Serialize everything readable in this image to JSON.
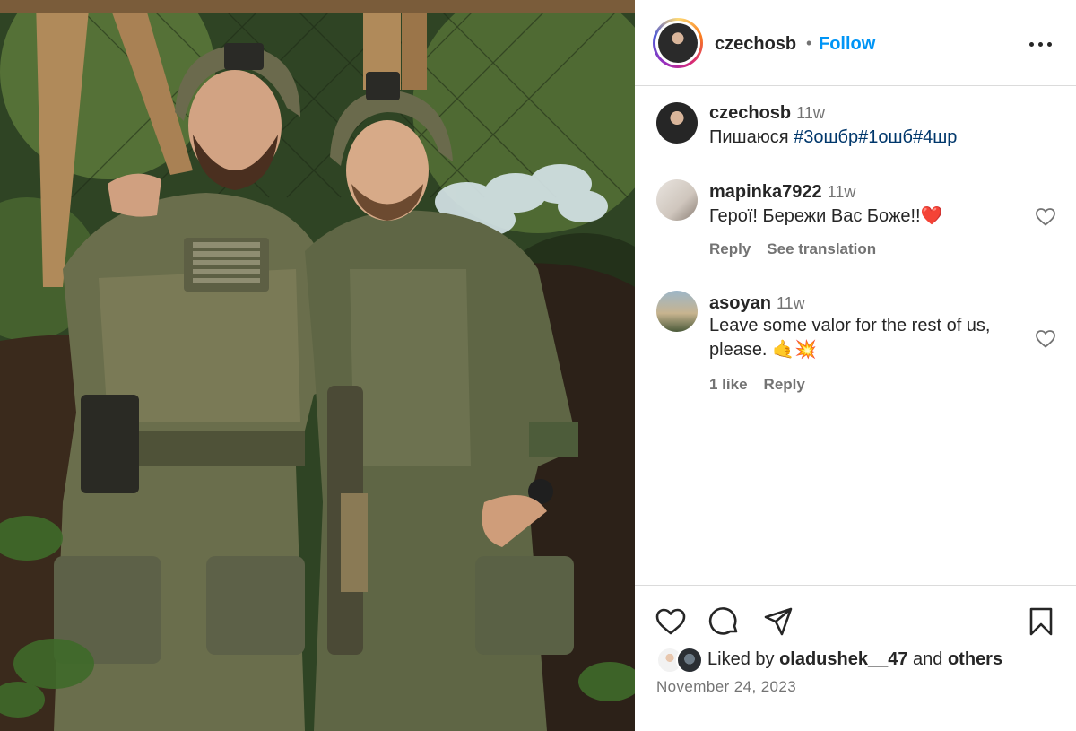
{
  "post": {
    "author": "czechosb",
    "follow_label": "Follow",
    "separator": "•",
    "caption": {
      "user": "czechosb",
      "time": "11w",
      "text": "Пишаюся ",
      "hashtags": "#3ошбр#1ошб#4шр"
    },
    "comments": [
      {
        "user": "mapinka7922",
        "time": "11w",
        "text": "Герої! Бережи Вас Боже!!❤️",
        "reply_label": "Reply",
        "translate_label": "See translation"
      },
      {
        "user": "asoyan",
        "time": "11w",
        "text": "Leave some valor for the rest of us, please. 🤙💥",
        "likes_label": "1 like",
        "reply_label": "Reply"
      }
    ],
    "liked_by": {
      "prefix": "Liked by ",
      "user": "oladushek__47",
      "middle": " and ",
      "others": "others"
    },
    "date": "November 24, 2023"
  },
  "icons": {
    "more": "more-options-icon",
    "heart": "heart-icon",
    "comment": "comment-icon",
    "share": "share-icon",
    "save": "bookmark-icon"
  },
  "colors": {
    "link_blue": "#0095f6",
    "hashtag_blue": "#00376b",
    "muted": "#737373",
    "text": "#262626",
    "divider": "#dbdbdb"
  }
}
